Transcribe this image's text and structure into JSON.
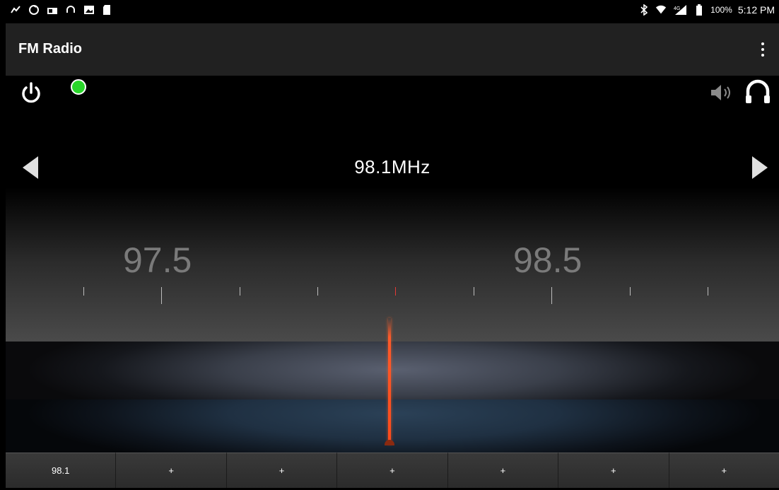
{
  "status_bar": {
    "battery": "100%",
    "time": "5:12 PM",
    "network": "4G"
  },
  "app_bar": {
    "title": "FM Radio"
  },
  "tuner": {
    "frequency": "98.1MHz",
    "scale_labels": [
      "97.5",
      "98.5"
    ],
    "band_position": 0.6,
    "radio_on": true,
    "status_color": "#29d62a",
    "needle_color": "#ff4a1a"
  },
  "presets": [
    "98.1",
    "+",
    "+",
    "+",
    "+",
    "+",
    "+"
  ],
  "icons": [
    "power-icon",
    "speaker-icon",
    "headphones-icon",
    "prev-arrow-icon",
    "next-arrow-icon",
    "overflow-menu-icon"
  ]
}
